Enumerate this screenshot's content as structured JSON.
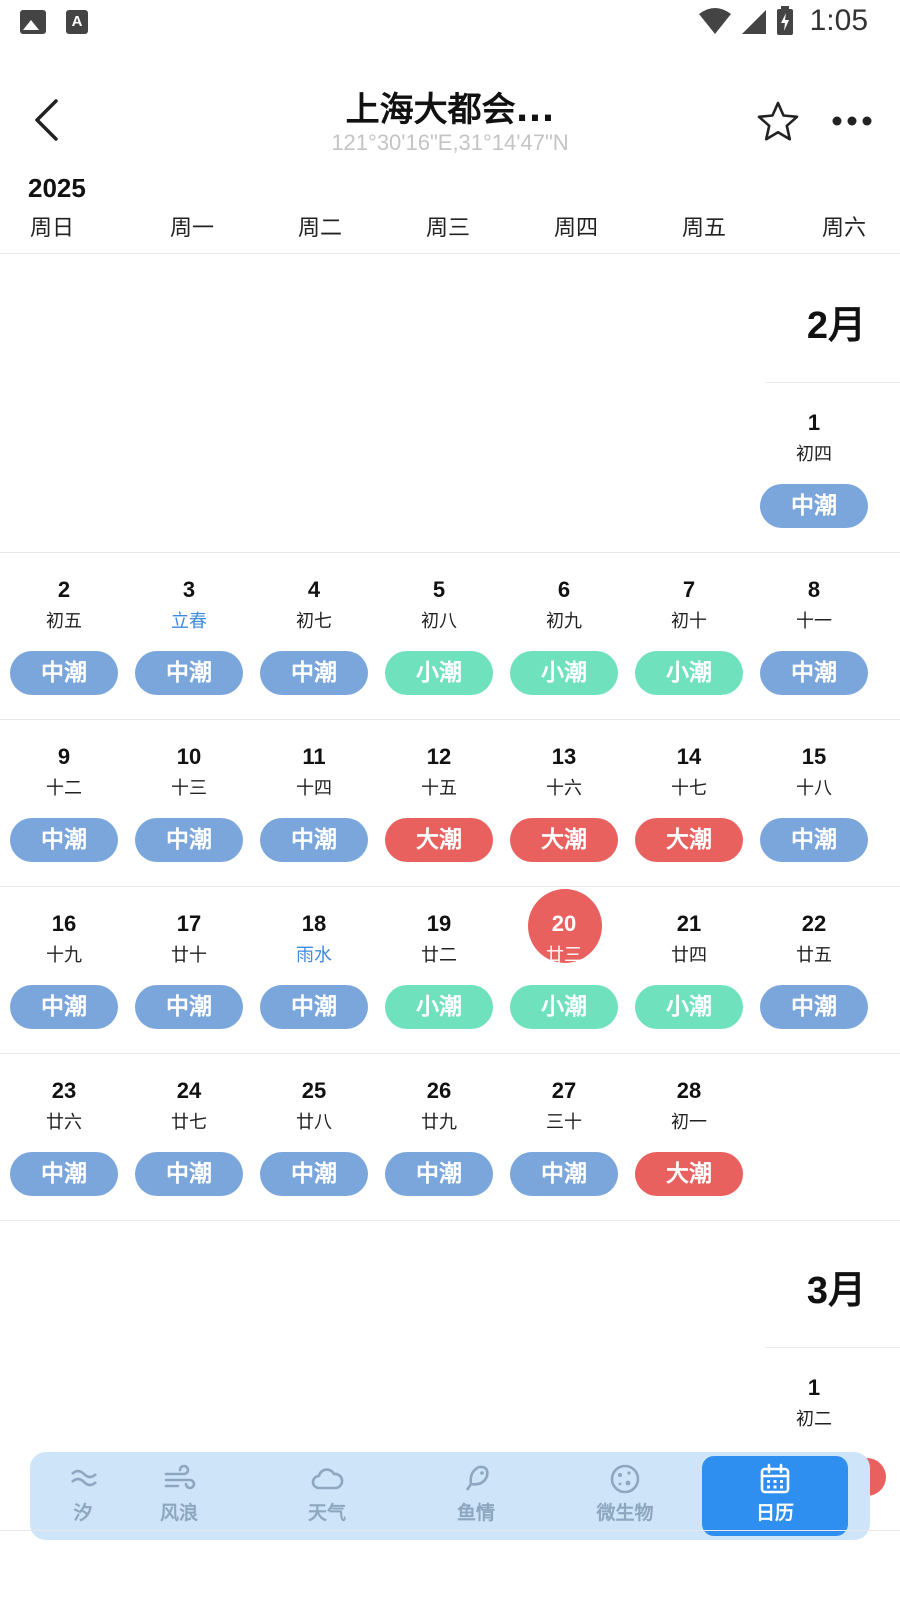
{
  "status_bar": {
    "time": "1:05"
  },
  "header": {
    "title": "上海大都会...",
    "coords": "121°30'16\"E,31°14'47\"N"
  },
  "year": "2025",
  "weekdays": [
    "周日",
    "周一",
    "周二",
    "周三",
    "周四",
    "周五",
    "周六"
  ],
  "colors": {
    "中潮": "#7ba6dc",
    "小潮": "#6fe2bd",
    "大潮": "#e8615f",
    "accent": "#2f8ff0"
  },
  "months": [
    {
      "label": "2月",
      "weeks": [
        [
          null,
          null,
          null,
          null,
          null,
          null,
          {
            "day": "1",
            "lunar": "初四",
            "tide": "中潮"
          }
        ],
        [
          {
            "day": "2",
            "lunar": "初五",
            "tide": "中潮"
          },
          {
            "day": "3",
            "lunar": "立春",
            "tide": "中潮",
            "term": true
          },
          {
            "day": "4",
            "lunar": "初七",
            "tide": "中潮"
          },
          {
            "day": "5",
            "lunar": "初八",
            "tide": "小潮"
          },
          {
            "day": "6",
            "lunar": "初九",
            "tide": "小潮"
          },
          {
            "day": "7",
            "lunar": "初十",
            "tide": "小潮"
          },
          {
            "day": "8",
            "lunar": "十一",
            "tide": "中潮"
          }
        ],
        [
          {
            "day": "9",
            "lunar": "十二",
            "tide": "中潮"
          },
          {
            "day": "10",
            "lunar": "十三",
            "tide": "中潮"
          },
          {
            "day": "11",
            "lunar": "十四",
            "tide": "中潮"
          },
          {
            "day": "12",
            "lunar": "十五",
            "tide": "大潮"
          },
          {
            "day": "13",
            "lunar": "十六",
            "tide": "大潮"
          },
          {
            "day": "14",
            "lunar": "十七",
            "tide": "大潮"
          },
          {
            "day": "15",
            "lunar": "十八",
            "tide": "中潮"
          }
        ],
        [
          {
            "day": "16",
            "lunar": "十九",
            "tide": "中潮"
          },
          {
            "day": "17",
            "lunar": "廿十",
            "tide": "中潮"
          },
          {
            "day": "18",
            "lunar": "雨水",
            "tide": "中潮",
            "term": true
          },
          {
            "day": "19",
            "lunar": "廿二",
            "tide": "小潮"
          },
          {
            "day": "20",
            "lunar": "廿三",
            "tide": "小潮",
            "today": true
          },
          {
            "day": "21",
            "lunar": "廿四",
            "tide": "小潮"
          },
          {
            "day": "22",
            "lunar": "廿五",
            "tide": "中潮"
          }
        ],
        [
          {
            "day": "23",
            "lunar": "廿六",
            "tide": "中潮"
          },
          {
            "day": "24",
            "lunar": "廿七",
            "tide": "中潮"
          },
          {
            "day": "25",
            "lunar": "廿八",
            "tide": "中潮"
          },
          {
            "day": "26",
            "lunar": "廿九",
            "tide": "中潮"
          },
          {
            "day": "27",
            "lunar": "三十",
            "tide": "中潮"
          },
          {
            "day": "28",
            "lunar": "初一",
            "tide": "大潮"
          },
          null
        ]
      ]
    },
    {
      "label": "3月",
      "weeks": [
        [
          null,
          null,
          null,
          null,
          null,
          null,
          {
            "day": "1",
            "lunar": "初二"
          }
        ]
      ]
    }
  ],
  "nav": [
    {
      "label": "汐",
      "icon": "tide-icon"
    },
    {
      "label": "风浪",
      "icon": "wind-icon"
    },
    {
      "label": "天气",
      "icon": "cloud-icon"
    },
    {
      "label": "鱼情",
      "icon": "fish-icon"
    },
    {
      "label": "微生物",
      "icon": "microbe-icon"
    },
    {
      "label": "日历",
      "icon": "calendar-icon",
      "active": true
    }
  ]
}
